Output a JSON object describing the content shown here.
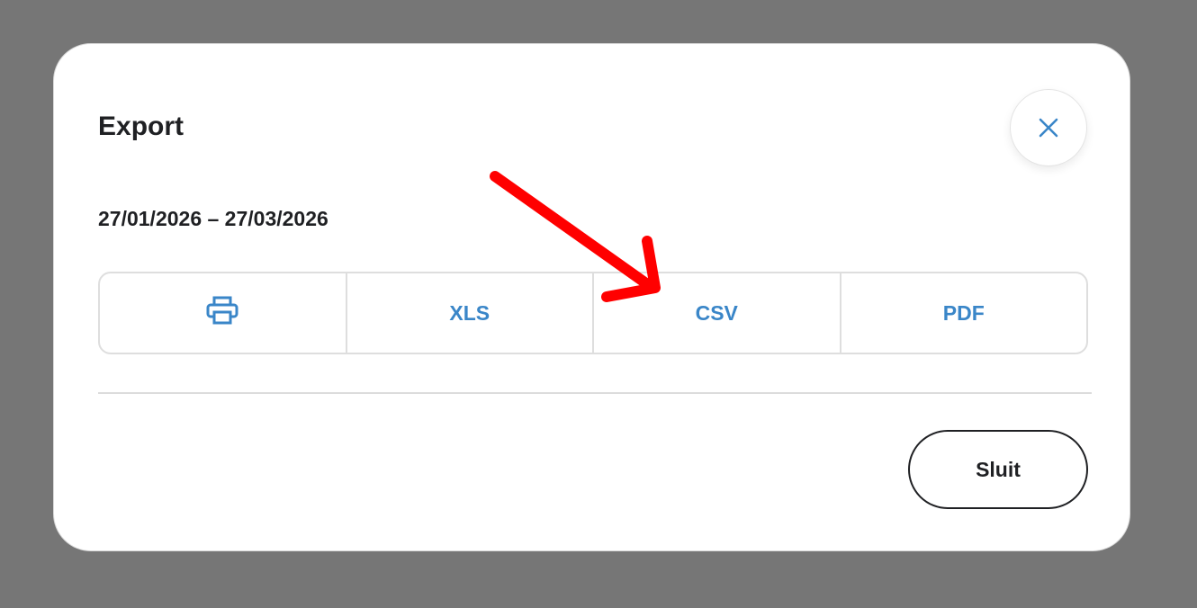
{
  "colors": {
    "backdrop": "#767676",
    "accent": "#3a86c8",
    "text": "#1f2023",
    "annotation_arrow": "#ff0000"
  },
  "modal": {
    "title": "Export",
    "close_icon": "close-icon",
    "date_range": "27/01/2026 – 27/03/2026",
    "export_options": [
      {
        "label": "",
        "icon": "print-icon"
      },
      {
        "label": "XLS"
      },
      {
        "label": "CSV"
      },
      {
        "label": "PDF"
      }
    ],
    "close_button_label": "Sluit"
  }
}
